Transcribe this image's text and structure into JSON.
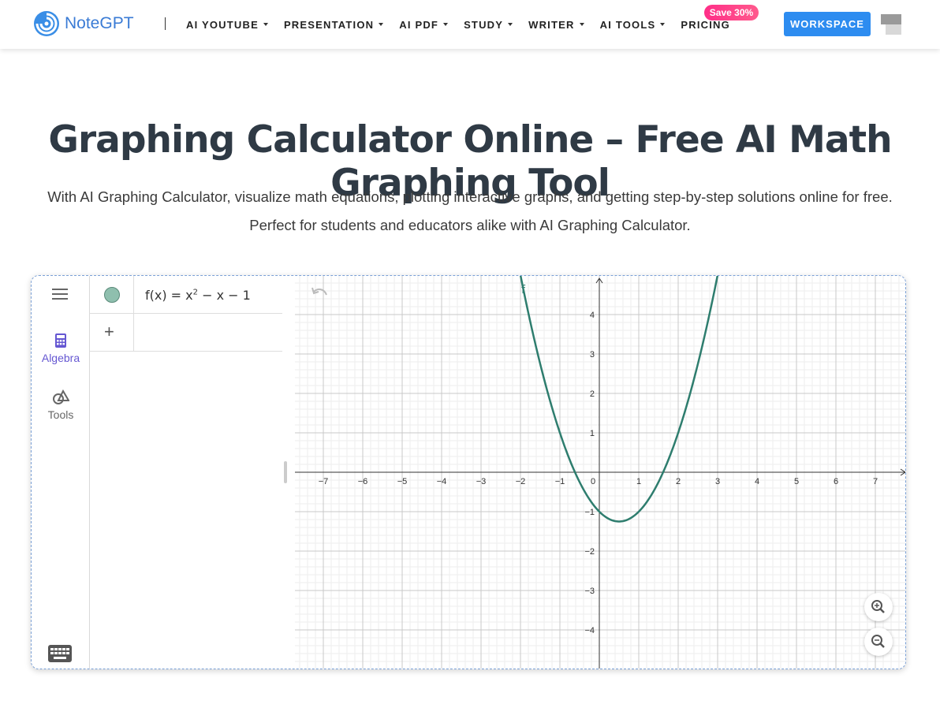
{
  "header": {
    "logo_text": "NoteGPT",
    "nav": [
      {
        "label": "AI YOUTUBE",
        "dropdown": true
      },
      {
        "label": "PRESENTATION",
        "dropdown": true
      },
      {
        "label": "AI PDF",
        "dropdown": true
      },
      {
        "label": "STUDY",
        "dropdown": true
      },
      {
        "label": "WRITER",
        "dropdown": true
      },
      {
        "label": "AI TOOLS",
        "dropdown": true
      },
      {
        "label": "PRICING",
        "dropdown": false
      }
    ],
    "save_badge": "Save 30%",
    "workspace_label": "WORKSPACE",
    "accent": "#2d8cf0"
  },
  "hero": {
    "title": "Graphing Calculator Online – Free AI Math Graphing Tool",
    "subtitle": "With AI Graphing Calculator, visualize math equations, plotting interactive graphs, and getting step-by-step solutions online for free. Perfect for students and educators alike with AI Graphing Calculator."
  },
  "calculator": {
    "tabs": [
      {
        "label": "Algebra",
        "icon": "calculator-icon",
        "active": true
      },
      {
        "label": "Tools",
        "icon": "shapes-icon",
        "active": false
      }
    ],
    "expression": {
      "prefix": "f(x) = x",
      "exponent": "2",
      "suffix": " − x − 1",
      "color": "#2e7d6e"
    },
    "add_symbol": "+",
    "curve_label": "f",
    "x_ticks": [
      "−7",
      "−6",
      "−5",
      "−4",
      "−3",
      "−2",
      "−1",
      "0",
      "1",
      "2",
      "3",
      "4",
      "5",
      "6",
      "7"
    ],
    "y_ticks": [
      "4",
      "3",
      "2",
      "1",
      "−1",
      "−2",
      "−3",
      "−4"
    ],
    "x_range": [
      -7.7,
      7.8
    ],
    "y_range": [
      -5,
      5
    ],
    "function": {
      "a": 1,
      "b": -1,
      "c": -1
    }
  }
}
